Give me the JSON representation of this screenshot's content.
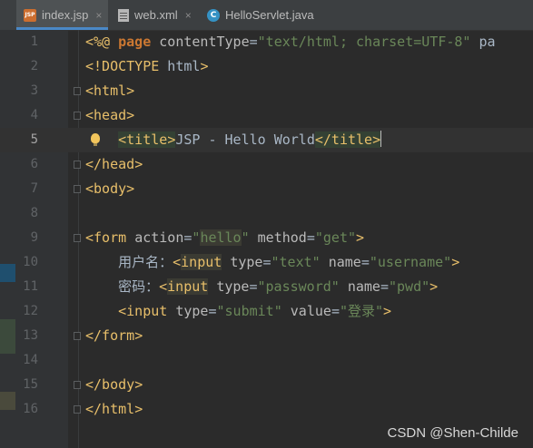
{
  "tabs": [
    {
      "label": "index.jsp",
      "icon": "jsp-file-icon",
      "active": true
    },
    {
      "label": "web.xml",
      "icon": "xml-file-icon",
      "active": false
    },
    {
      "label": "HelloServlet.java",
      "icon": "java-class-icon",
      "active": false
    }
  ],
  "tab_close_glyph": "×",
  "jsp_icon_text": "JSP",
  "class_icon_text": "C",
  "gutter_markers": [
    {
      "color": "#1f4f6e"
    },
    {
      "color": "#3c4a3c"
    },
    {
      "color": "#4a4a3c"
    }
  ],
  "colors": {
    "background": "#2b2b2b",
    "tag": "#e8bf6a",
    "string": "#6a8759",
    "keyword": "#cc7832",
    "text": "#a9b7c6",
    "active_tab_underline": "#4a88c7"
  },
  "current_line": 5,
  "editor": {
    "lines": [
      {
        "n": "1",
        "text": "<%@ page contentType=\"text/html; charset=UTF-8\" pa"
      },
      {
        "n": "2",
        "text": "<!DOCTYPE html>"
      },
      {
        "n": "3",
        "text": "<html>"
      },
      {
        "n": "4",
        "text": "<head>"
      },
      {
        "n": "5",
        "text": "    <title>JSP - Hello World</title>"
      },
      {
        "n": "6",
        "text": "</head>"
      },
      {
        "n": "7",
        "text": "<body>"
      },
      {
        "n": "8",
        "text": ""
      },
      {
        "n": "9",
        "text": "<form action=\"hello\" method=\"get\">"
      },
      {
        "n": "10",
        "text": "    用户名：<input type=\"text\" name=\"username\">"
      },
      {
        "n": "11",
        "text": "    密码：<input type=\"password\" name=\"pwd\">"
      },
      {
        "n": "12",
        "text": "    <input type=\"submit\" value=\"登录\">"
      },
      {
        "n": "13",
        "text": "</form>"
      },
      {
        "n": "14",
        "text": ""
      },
      {
        "n": "15",
        "text": "</body>"
      },
      {
        "n": "16",
        "text": "</html>"
      }
    ]
  },
  "watermark": "CSDN @Shen-Childe"
}
